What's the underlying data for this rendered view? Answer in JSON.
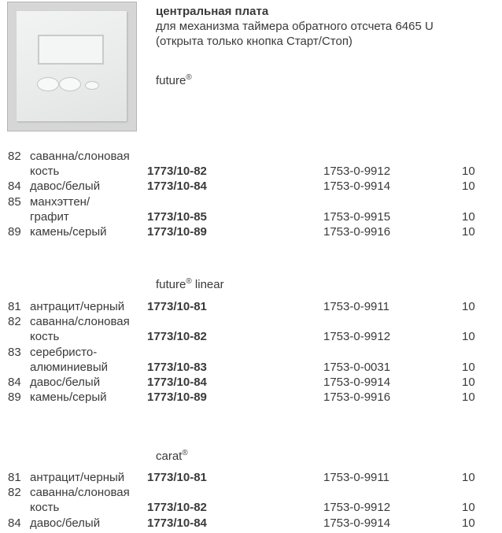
{
  "header": {
    "title": "центральная плата",
    "line1": "для механизма таймера обратного отсчета 6465 U",
    "line2": "(открыта только кнопка Старт/Стоп)"
  },
  "sections": [
    {
      "brand": "future",
      "brand_suffix": "",
      "rows": [
        [
          "82",
          "саванна/слоновая",
          "",
          "",
          ""
        ],
        [
          "",
          "кость",
          "1773/10-82",
          "1753-0-9912",
          "10"
        ],
        [
          "84",
          "давос/белый",
          "1773/10-84",
          "1753-0-9914",
          "10"
        ],
        [
          "85",
          "манхэттен/",
          "",
          "",
          ""
        ],
        [
          "",
          "графит",
          "1773/10-85",
          "1753-0-9915",
          "10"
        ],
        [
          "89",
          "камень/серый",
          "1773/10-89",
          "1753-0-9916",
          "10"
        ]
      ]
    },
    {
      "brand": "future",
      "brand_suffix": " linear",
      "rows": [
        [
          "81",
          "антрацит/черный",
          "1773/10-81",
          "1753-0-9911",
          "10"
        ],
        [
          "82",
          "саванна/слоновая",
          "",
          "",
          ""
        ],
        [
          "",
          "кость",
          "1773/10-82",
          "1753-0-9912",
          "10"
        ],
        [
          "83",
          "серебристо-",
          "",
          "",
          ""
        ],
        [
          "",
          "алюминиевый",
          "1773/10-83",
          "1753-0-0031",
          "10"
        ],
        [
          "84",
          "давос/белый",
          "1773/10-84",
          "1753-0-9914",
          "10"
        ],
        [
          "89",
          "камень/серый",
          "1773/10-89",
          "1753-0-9916",
          "10"
        ]
      ]
    },
    {
      "brand": "carat",
      "brand_suffix": "",
      "rows": [
        [
          "81",
          "антрацит/черный",
          "1773/10-81",
          "1753-0-9911",
          "10"
        ],
        [
          "82",
          "саванна/слоновая",
          "",
          "",
          ""
        ],
        [
          "",
          "кость",
          "1773/10-82",
          "1753-0-9912",
          "10"
        ],
        [
          "84",
          "давос/белый",
          "1773/10-84",
          "1753-0-9914",
          "10"
        ]
      ]
    }
  ]
}
